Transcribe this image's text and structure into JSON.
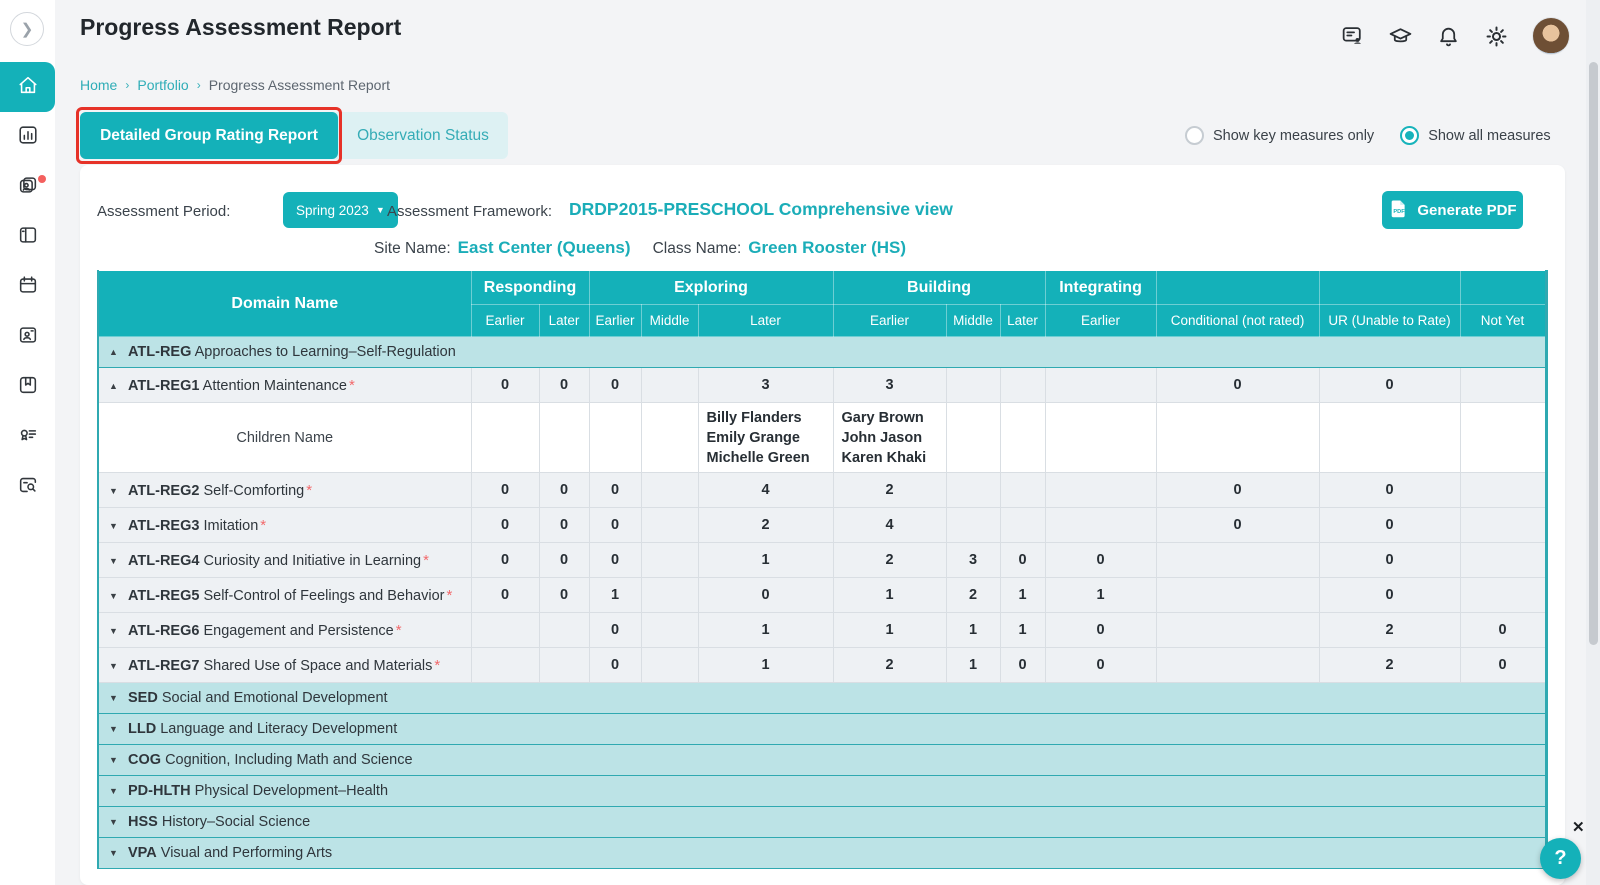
{
  "app": {
    "title": "Progress Assessment Report"
  },
  "breadcrumb": {
    "items": [
      "Home",
      "Portfolio",
      "Progress Assessment Report"
    ],
    "separator": "›"
  },
  "topbar": {
    "icons": [
      "feedback-icon",
      "graduation-cap-icon",
      "bell-icon",
      "gear-icon"
    ],
    "avatar": "user-avatar"
  },
  "sidebar": {
    "icons": [
      "home",
      "bar-chart",
      "profile-cards",
      "panel-layout",
      "calendar",
      "id-badge",
      "bookmark",
      "certificate",
      "record-search"
    ],
    "active": "home",
    "notification_on": "profile-cards"
  },
  "tabs": [
    {
      "label": "Detailed Group Rating Report",
      "active": true,
      "highlighted": true
    },
    {
      "label": "Observation Status",
      "active": false,
      "highlighted": false
    }
  ],
  "measure_filter": {
    "options": [
      {
        "label": "Show key measures only",
        "selected": false
      },
      {
        "label": "Show all measures",
        "selected": true
      }
    ]
  },
  "controls": {
    "period_label": "Assessment Period:",
    "period_value": "Spring 2023",
    "framework_label": "Assessment Framework:",
    "framework_value": "DRDP2015-PRESCHOOL Comprehensive view",
    "site_label": "Site Name:",
    "site_value": "East Center (Queens)",
    "class_label": "Class Name:",
    "class_value": "Green Rooster (HS)",
    "generate_pdf_label": "Generate PDF"
  },
  "table": {
    "domain_header": "Domain Name",
    "level_groups": [
      {
        "label": "Responding",
        "sub": [
          "Earlier",
          "Later"
        ]
      },
      {
        "label": "Exploring",
        "sub": [
          "Earlier",
          "Middle",
          "Later"
        ]
      },
      {
        "label": "Building",
        "sub": [
          "Earlier",
          "Middle",
          "Later"
        ]
      },
      {
        "label": "Integrating",
        "sub": [
          "Earlier"
        ]
      }
    ],
    "extra_columns": [
      "Conditional (not rated)",
      "UR (Unable to Rate)",
      "Not Yet"
    ],
    "rows": [
      {
        "type": "group",
        "code": "ATL-REG",
        "name": "Approaches to Learning–Self-Regulation",
        "expanded": true
      },
      {
        "type": "measure",
        "code": "ATL-REG1",
        "name": "Attention Maintenance",
        "key": true,
        "expanded": true,
        "values": [
          "0",
          "0",
          "0",
          "",
          "3",
          "3",
          "",
          "",
          "",
          "0",
          "0",
          ""
        ]
      },
      {
        "type": "children",
        "label": "Children Name",
        "values": [
          "",
          "",
          "",
          "",
          [
            "Billy Flanders",
            "Emily Grange",
            "Michelle Green"
          ],
          [
            "Gary Brown",
            "John Jason",
            "Karen Khaki"
          ],
          "",
          "",
          "",
          "",
          "",
          ""
        ]
      },
      {
        "type": "measure",
        "code": "ATL-REG2",
        "name": "Self-Comforting",
        "key": true,
        "expanded": false,
        "values": [
          "0",
          "0",
          "0",
          "",
          "4",
          "2",
          "",
          "",
          "",
          "0",
          "0",
          ""
        ]
      },
      {
        "type": "measure",
        "code": "ATL-REG3",
        "name": "Imitation",
        "key": true,
        "expanded": false,
        "values": [
          "0",
          "0",
          "0",
          "",
          "2",
          "4",
          "",
          "",
          "",
          "0",
          "0",
          ""
        ]
      },
      {
        "type": "measure",
        "code": "ATL-REG4",
        "name": "Curiosity and Initiative in Learning",
        "key": true,
        "expanded": false,
        "values": [
          "0",
          "0",
          "0",
          "",
          "1",
          "2",
          "3",
          "0",
          "0",
          "",
          "0",
          ""
        ]
      },
      {
        "type": "measure",
        "code": "ATL-REG5",
        "name": "Self-Control of Feelings and Behavior",
        "key": true,
        "expanded": false,
        "values": [
          "0",
          "0",
          "1",
          "",
          "0",
          "1",
          "2",
          "1",
          "1",
          "",
          "0",
          ""
        ]
      },
      {
        "type": "measure",
        "code": "ATL-REG6",
        "name": "Engagement and Persistence",
        "key": true,
        "expanded": false,
        "values": [
          "",
          "",
          "0",
          "",
          "1",
          "1",
          "1",
          "1",
          "0",
          "",
          "2",
          "0"
        ]
      },
      {
        "type": "measure",
        "code": "ATL-REG7",
        "name": "Shared Use of Space and Materials",
        "key": true,
        "expanded": false,
        "values": [
          "",
          "",
          "0",
          "",
          "1",
          "2",
          "1",
          "0",
          "0",
          "",
          "2",
          "0"
        ]
      },
      {
        "type": "group",
        "code": "SED",
        "name": "Social and Emotional Development",
        "expanded": false
      },
      {
        "type": "group",
        "code": "LLD",
        "name": "Language and Literacy Development",
        "expanded": false
      },
      {
        "type": "group",
        "code": "COG",
        "name": "Cognition, Including Math and Science",
        "expanded": false
      },
      {
        "type": "group",
        "code": "PD-HLTH",
        "name": "Physical Development–Health",
        "expanded": false
      },
      {
        "type": "group",
        "code": "HSS",
        "name": "History–Social Science",
        "expanded": false
      },
      {
        "type": "group",
        "code": "VPA",
        "name": "Visual and Performing Arts",
        "expanded": false
      }
    ]
  },
  "help": {
    "label": "?",
    "close": "✕"
  },
  "colors": {
    "primary": "#14b1b9",
    "group_row_bg": "#bce3e6",
    "tab_inactive_bg": "#ddf1f3",
    "annotation_red": "#e63228",
    "asterisk_red": "#f2696b"
  }
}
